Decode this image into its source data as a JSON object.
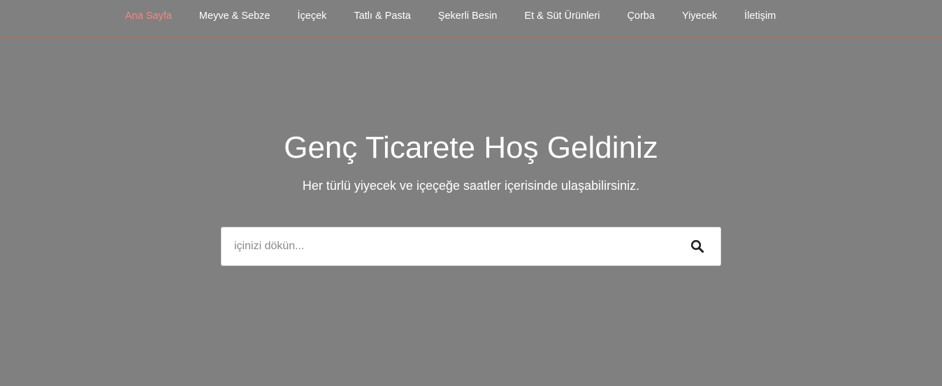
{
  "nav": {
    "items": [
      {
        "label": "Ana Sayfa",
        "active": true
      },
      {
        "label": "Meyve & Sebze",
        "active": false
      },
      {
        "label": "İçeçek",
        "active": false
      },
      {
        "label": "Tatlı & Pasta",
        "active": false
      },
      {
        "label": "Şekerli Besin",
        "active": false
      },
      {
        "label": "Et & Süt Ürünleri",
        "active": false
      },
      {
        "label": "Çorba",
        "active": false
      },
      {
        "label": "Yiyecek",
        "active": false
      },
      {
        "label": "İletişim",
        "active": false
      }
    ],
    "active_color": "#f08a80",
    "divider_color": "#c0605a"
  },
  "hero": {
    "title": "Genç Ticarete Hoş Geldiniz",
    "subtitle": "Her türlü yiyecek ve içeçeğe saatler içerisinde ulaşabilirsiniz."
  },
  "search": {
    "placeholder": "içinizi dökün...",
    "value": "",
    "icon": "search-icon"
  },
  "colors": {
    "background": "#808080",
    "text": "#ffffff"
  }
}
